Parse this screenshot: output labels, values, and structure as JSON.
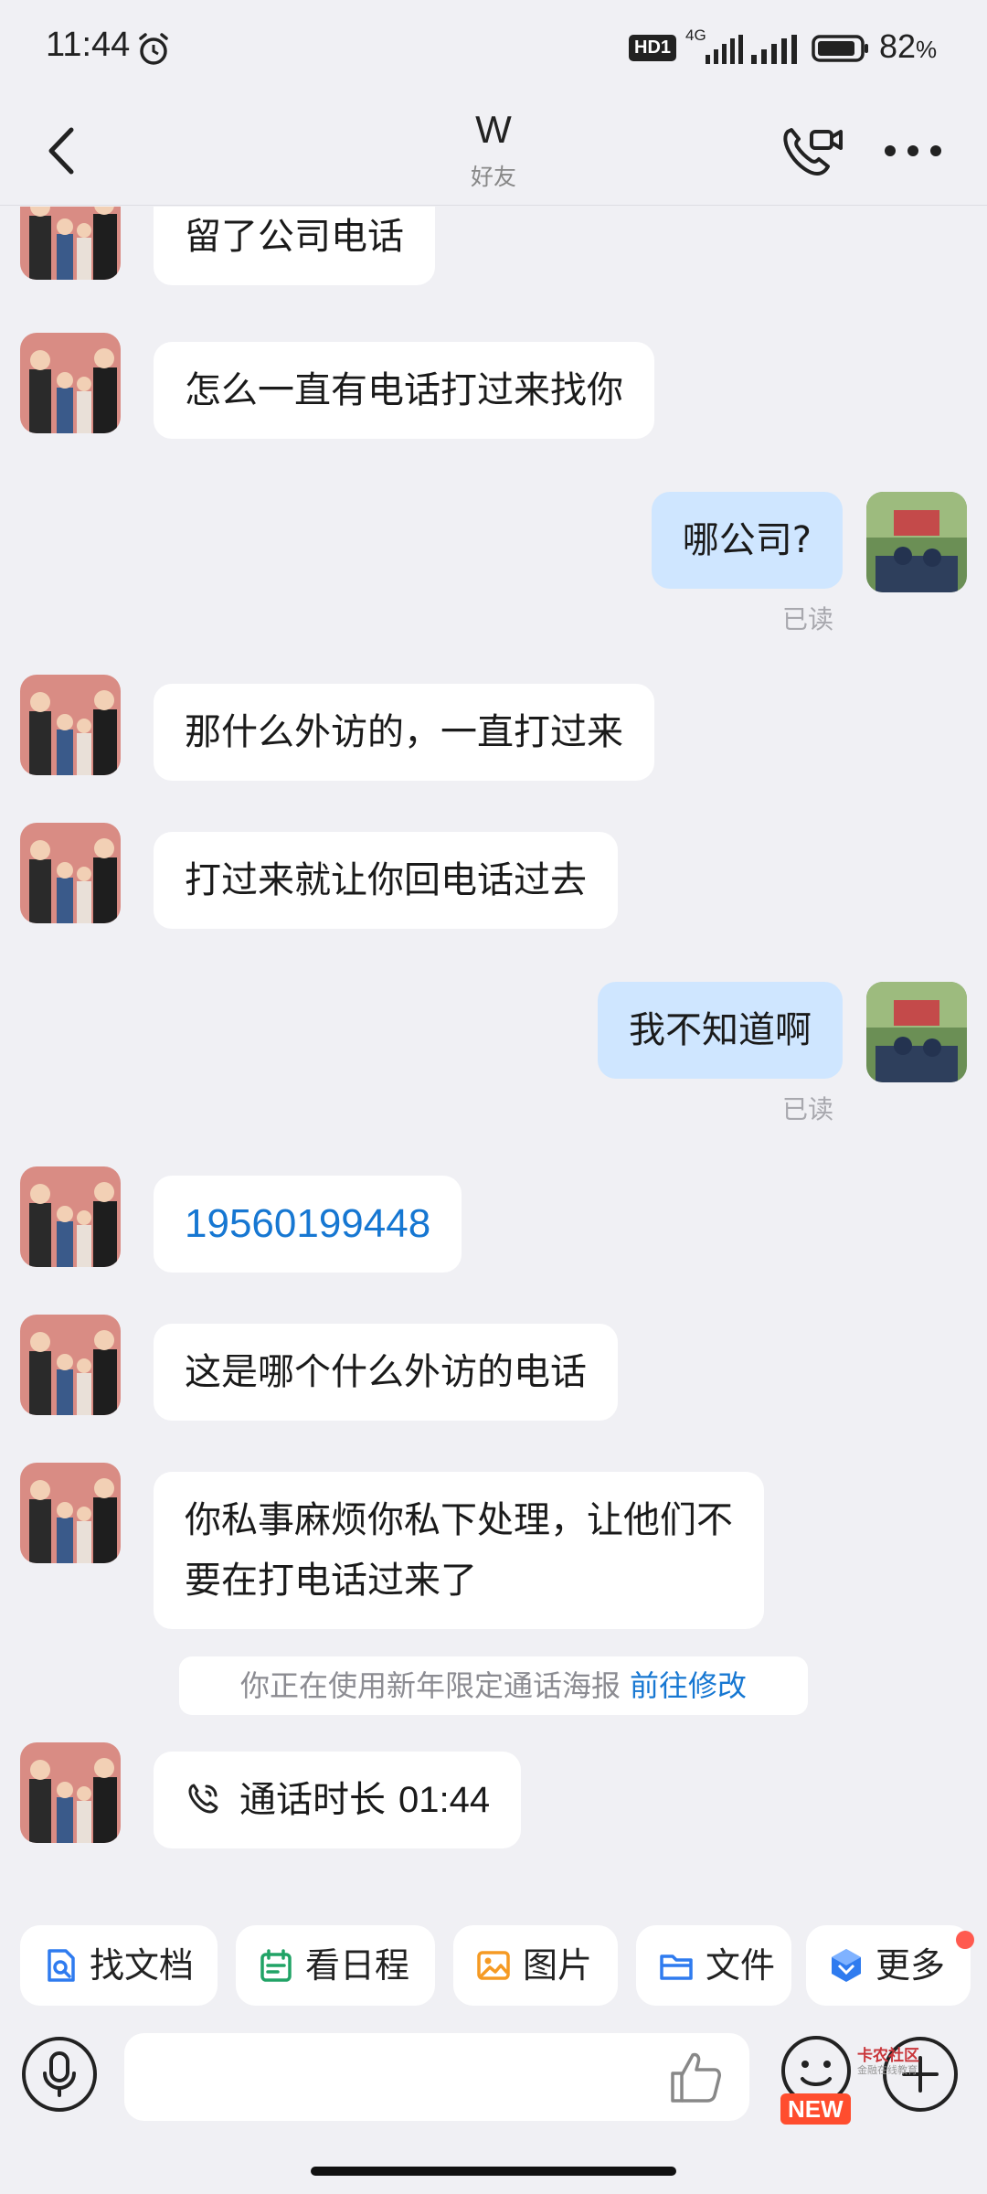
{
  "status_bar": {
    "time": "11:44",
    "hd_label": "HD1",
    "network_label": "4G",
    "battery_percent": "82",
    "battery_unit": "%"
  },
  "header": {
    "title": "W",
    "subtitle": "好友"
  },
  "messages": [
    {
      "dir": "in",
      "text": "留了公司电话"
    },
    {
      "dir": "in",
      "text": "怎么一直有电话打过来找你"
    },
    {
      "dir": "out",
      "text": "哪公司?",
      "read": "已读"
    },
    {
      "dir": "in",
      "text": "那什么外访的，一直打过来"
    },
    {
      "dir": "in",
      "text": "打过来就让你回电话过去"
    },
    {
      "dir": "out",
      "text": "我不知道啊",
      "read": "已读"
    },
    {
      "dir": "in",
      "text": "19560199448"
    },
    {
      "dir": "in",
      "text": "这是哪个什么外访的电话"
    },
    {
      "dir": "in",
      "text_line1": "你私事麻烦你私下处理，让他们不",
      "text_line2": "要在打电话过来了"
    },
    {
      "type": "system",
      "text": "你正在使用新年限定通话海报",
      "link": "前往修改"
    },
    {
      "dir": "in",
      "type": "call",
      "label": "通话时长",
      "duration": "01:44"
    }
  ],
  "quick_actions": [
    {
      "label": "找文档",
      "icon": "search-doc-icon"
    },
    {
      "label": "看日程",
      "icon": "calendar-icon"
    },
    {
      "label": "图片",
      "icon": "image-icon"
    },
    {
      "label": "文件",
      "icon": "folder-icon"
    },
    {
      "label": "更多",
      "icon": "more-apps-icon"
    }
  ],
  "input": {
    "placeholder": ""
  },
  "badges": {
    "new": "NEW"
  },
  "watermark": {
    "title": "卡农社区",
    "subtitle": "金融在线教育"
  },
  "colors": {
    "background": "#F0F0F4",
    "outgoing_bubble": "#CFE6FF",
    "link": "#1677D2",
    "accent_red": "#FF5A4F"
  }
}
